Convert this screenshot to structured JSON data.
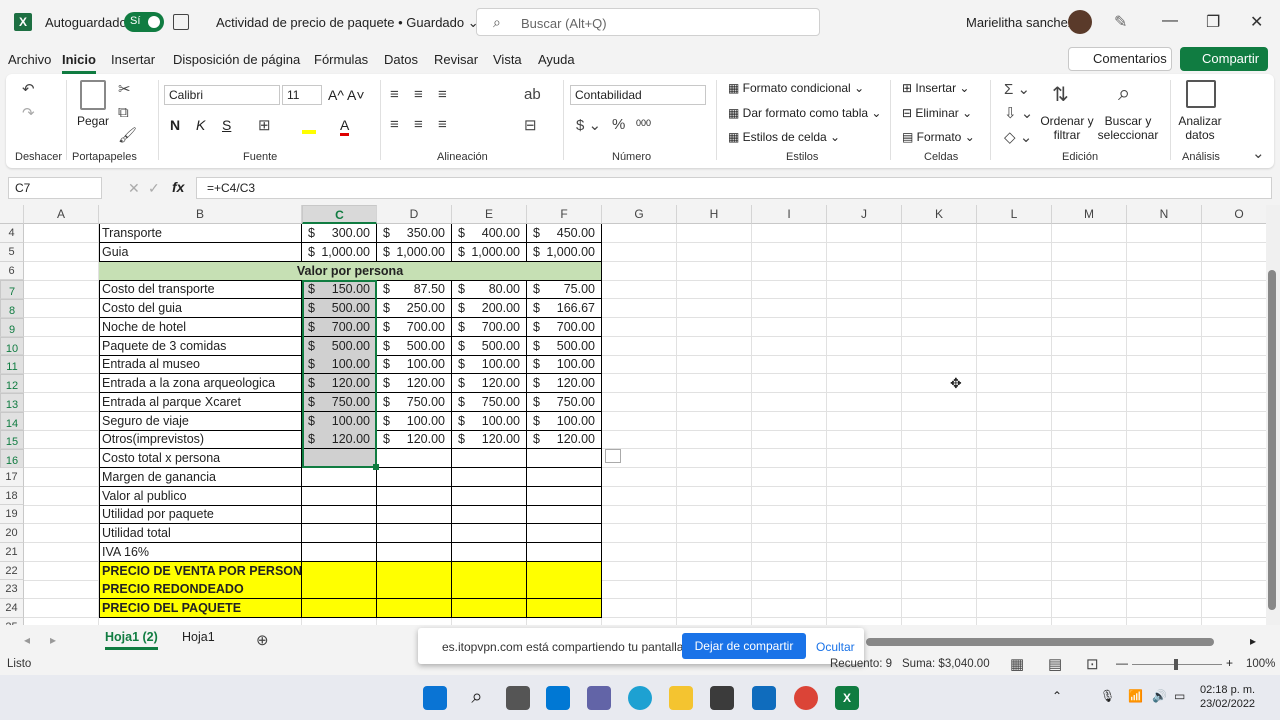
{
  "titlebar": {
    "autosave": "Autoguardado",
    "toggle_label": "Sí",
    "title": "Actividad de precio de paquete • Guardado",
    "search_placeholder": "Buscar (Alt+Q)",
    "user": "Marielitha sanchez"
  },
  "menu": [
    "Archivo",
    "Inicio",
    "Insertar",
    "Disposición de página",
    "Fórmulas",
    "Datos",
    "Revisar",
    "Vista",
    "Ayuda"
  ],
  "menu_right": {
    "comments": "Comentarios",
    "share": "Compartir"
  },
  "ribbon": {
    "undo_label": "Deshacer",
    "paste": "Pegar",
    "clipboard_label": "Portapapeles",
    "font_name": "Calibri",
    "font_size": "11",
    "font_label": "Fuente",
    "align_label": "Alineación",
    "number_format": "Contabilidad",
    "number_label": "Número",
    "cond_format": "Formato condicional",
    "table_format": "Dar formato como tabla",
    "cell_styles": "Estilos de celda",
    "styles_label": "Estilos",
    "insert": "Insertar",
    "delete": "Eliminar",
    "format": "Formato",
    "cells_label": "Celdas",
    "sort": "Ordenar y filtrar",
    "find": "Buscar y seleccionar",
    "edit_label": "Edición",
    "analyze": "Analizar datos",
    "analysis_label": "Análisis"
  },
  "formula_bar": {
    "cell_ref": "C7",
    "formula": "=+C4/C3"
  },
  "columns": [
    "A",
    "B",
    "C",
    "D",
    "E",
    "F",
    "G",
    "H",
    "I",
    "J",
    "K",
    "L",
    "M",
    "N",
    "O"
  ],
  "rows": [
    {
      "n": "4",
      "label": "Transporte",
      "vals": [
        "300.00",
        "350.00",
        "400.00",
        "450.00"
      ]
    },
    {
      "n": "5",
      "label": "Guia",
      "vals": [
        "1,000.00",
        "1,000.00",
        "1,000.00",
        "1,000.00"
      ]
    },
    {
      "n": "6",
      "label": "Valor por persona",
      "merged": true
    },
    {
      "n": "7",
      "label": "Costo del transporte",
      "vals": [
        "150.00",
        "87.50",
        "80.00",
        "75.00"
      ]
    },
    {
      "n": "8",
      "label": "Costo del guia",
      "vals": [
        "500.00",
        "250.00",
        "200.00",
        "166.67"
      ]
    },
    {
      "n": "9",
      "label": "Noche de hotel",
      "vals": [
        "700.00",
        "700.00",
        "700.00",
        "700.00"
      ]
    },
    {
      "n": "10",
      "label": "Paquete de 3 comidas",
      "vals": [
        "500.00",
        "500.00",
        "500.00",
        "500.00"
      ]
    },
    {
      "n": "11",
      "label": "Entrada al museo",
      "vals": [
        "100.00",
        "100.00",
        "100.00",
        "100.00"
      ]
    },
    {
      "n": "12",
      "label": "Entrada a la zona arqueologica",
      "vals": [
        "120.00",
        "120.00",
        "120.00",
        "120.00"
      ]
    },
    {
      "n": "13",
      "label": "Entrada al parque Xcaret",
      "vals": [
        "750.00",
        "750.00",
        "750.00",
        "750.00"
      ]
    },
    {
      "n": "14",
      "label": "Seguro de viaje",
      "vals": [
        "100.00",
        "100.00",
        "100.00",
        "100.00"
      ]
    },
    {
      "n": "15",
      "label": "Otros(imprevistos)",
      "vals": [
        "120.00",
        "120.00",
        "120.00",
        "120.00"
      ]
    },
    {
      "n": "16",
      "label": "Costo total x persona"
    },
    {
      "n": "17",
      "label": "Margen de ganancia"
    },
    {
      "n": "18",
      "label": "Valor al publico"
    },
    {
      "n": "19",
      "label": "Utilidad por paquete"
    },
    {
      "n": "20",
      "label": "Utilidad total"
    },
    {
      "n": "21",
      "label": "IVA 16%"
    },
    {
      "n": "22",
      "label": "PRECIO DE VENTA POR PERSONA",
      "yellow": true
    },
    {
      "n": "23",
      "label": "PRECIO REDONDEADO",
      "yellow": true
    },
    {
      "n": "24",
      "label": "PRECIO DEL PAQUETE",
      "yellow": true
    },
    {
      "n": "25",
      "label": ""
    }
  ],
  "currency": "$",
  "sheets": [
    "Hoja1 (2)",
    "Hoja1"
  ],
  "share_notice": {
    "msg": "es.itopvpn.com está compartiendo tu pantalla.",
    "stop": "Dejar de compartir",
    "hide": "Ocultar"
  },
  "status": {
    "ready": "Listo",
    "count": "Recuento: 9",
    "sum": "Suma:  $3,040.00",
    "zoom": "100%"
  },
  "clock": {
    "time": "02:18 p. m.",
    "date": "23/02/2022"
  },
  "colors": {
    "excel_green": "#107c41",
    "header_green": "#c6e0b4",
    "highlight_yellow": "#ffff00"
  }
}
